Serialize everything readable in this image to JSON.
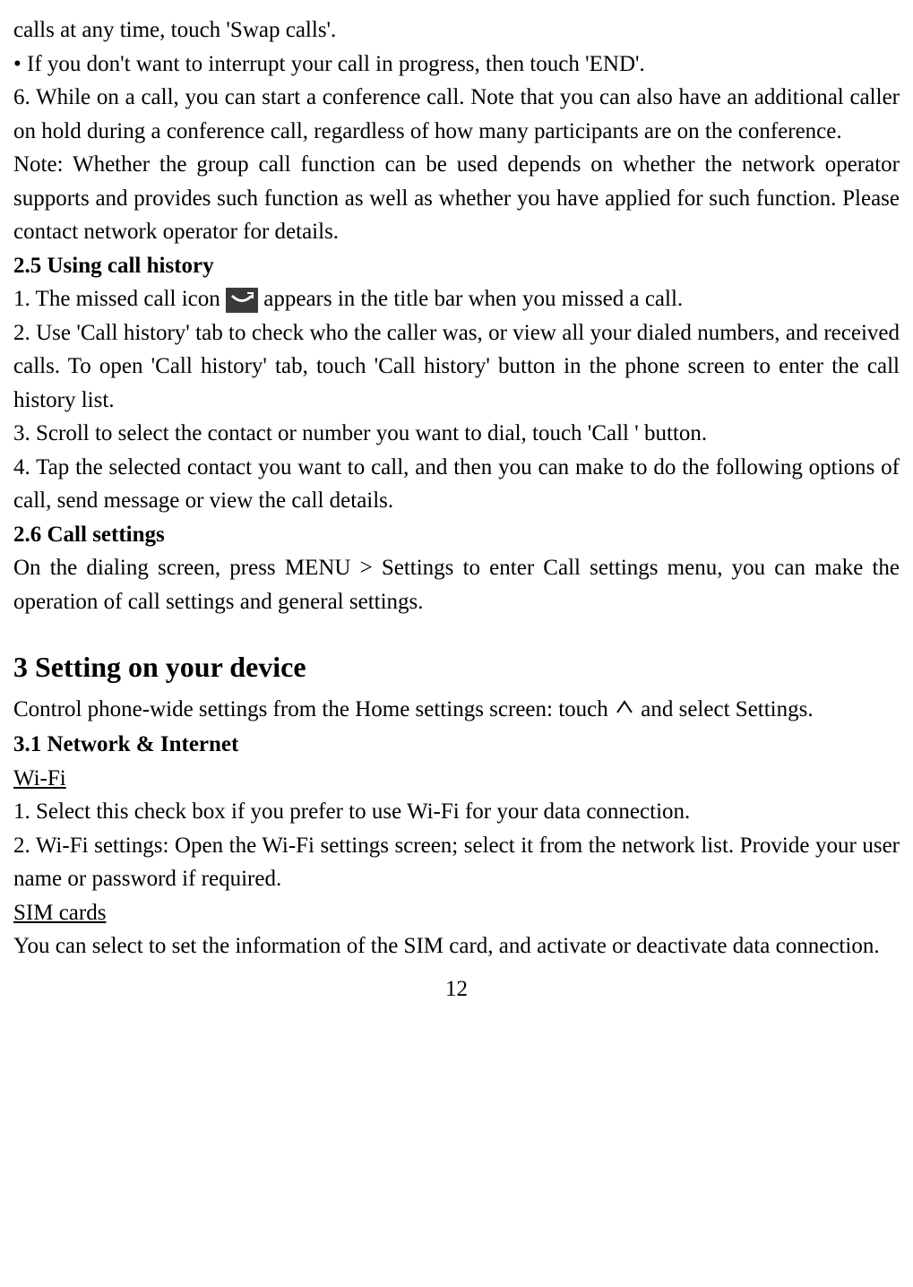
{
  "lines": {
    "l1": "calls at any time, touch 'Swap calls'.",
    "l2": "• If you don't want to interrupt your call in progress, then touch 'END'.",
    "l3": "6. While on a call, you can start a conference call. Note that you can also have an additional caller on hold during a conference call, regardless of how many participants are on the conference.",
    "l4": "Note: Whether the group call function can be used depends on whether the network operator supports and provides such function as well as whether you have applied for such function. Please contact network operator for details.",
    "h25": "2.5 Using call history",
    "l5a": "1. The missed call icon ",
    "l5b": " appears in the title bar when you missed a call.",
    "l6": "2. Use 'Call history' tab to check who the caller was, or view all your dialed numbers, and received calls. To open 'Call history' tab, touch 'Call history' button in the phone screen to enter the call history list.",
    "l7": "3. Scroll to select the contact or number you want to dial, touch 'Call ' button.",
    "l8": "4. Tap the selected contact you want to call, and then you can make to do the following options of call, send message or view the call details.",
    "h26": "2.6 Call settings",
    "l9": "On the dialing screen, press MENU > Settings to enter Call settings menu, you can make the operation of call settings and general settings.",
    "h3": "3 Setting on your device",
    "l10a": "Control phone-wide settings from the Home settings screen: touch ",
    "l10b": " and select Settings.",
    "h31": "3.1 Network & Internet",
    "wifi": "Wi-Fi",
    "l11": "1. Select this check box if you prefer to use Wi-Fi for your data connection.",
    "l12": "2. Wi-Fi settings: Open the Wi-Fi settings screen; select it from the network list. Provide your user name or password if required.",
    "sim": "SIM cards",
    "l13": "You can select to set the information of the SIM card, and activate or deactivate data connection.",
    "page": "12"
  }
}
